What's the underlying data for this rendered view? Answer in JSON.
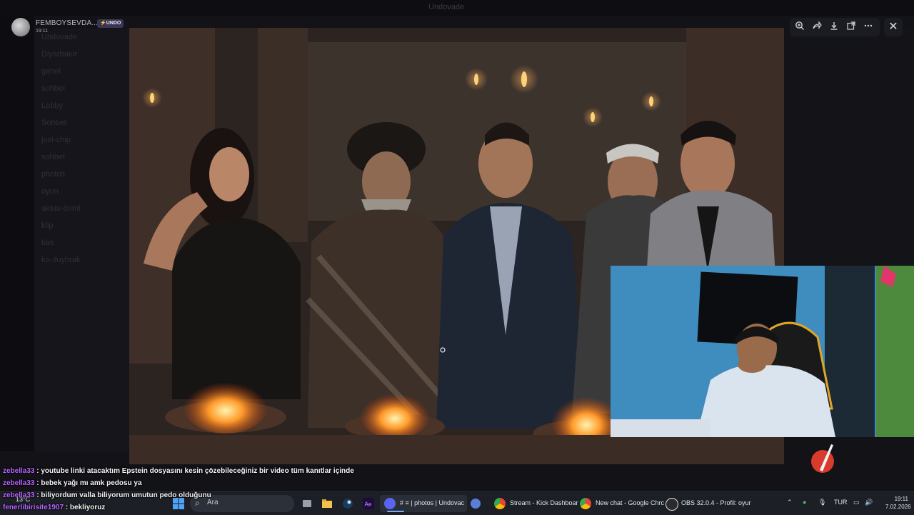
{
  "background": {
    "window_title": "Undovade",
    "channels": [
      "Undovade",
      "Diyarbakır",
      "genel",
      "sohbet",
      "Lobby",
      "Sohbet",
      "just-chip",
      "sohbet",
      "photos",
      "oyun",
      "aktuu-önml",
      "klip",
      "bas",
      "ko-duyhrak"
    ]
  },
  "viewer": {
    "username": "FEMBOYSEVDA...",
    "badge": "⚡UNDO",
    "time": "19:11",
    "tools": [
      "zoom-in-icon",
      "share-icon",
      "download-icon",
      "open-external-icon",
      "more-icon"
    ],
    "close": "✕"
  },
  "chat": [
    {
      "user": "zebella33",
      "text": " : youtube linki atacaktım Epstein dosyasını kesin çözebileceğiniz bir video tüm kanıtlar içinde"
    },
    {
      "user": "zebella33",
      "text": " : bebek yağı mı amk pedosu ya"
    },
    {
      "user": "zebella33",
      "text": " : biliyordum valla biliyorum umutun pedo olduğunu"
    },
    {
      "user": "fenerlibirisite1907",
      "text": " : bekliyoruz"
    }
  ],
  "taskbar": {
    "weather": "13°C",
    "search_placeholder": "Ara",
    "apps": [
      {
        "label": "# ≡ | photos | Undovac",
        "badge": "99+"
      },
      {
        "label": "Stream - Kick Dashboar"
      },
      {
        "label": "New chat - Google Chrc"
      },
      {
        "label": "OBS 32.0.4 - Profil: oyur"
      }
    ],
    "language": "TUR",
    "time": "19:11",
    "date": "7.02.2026"
  },
  "colors": {
    "chat_username": "#b565ff",
    "accent_blue": "#7aa6ff",
    "obs_red": "#d83a2c"
  }
}
